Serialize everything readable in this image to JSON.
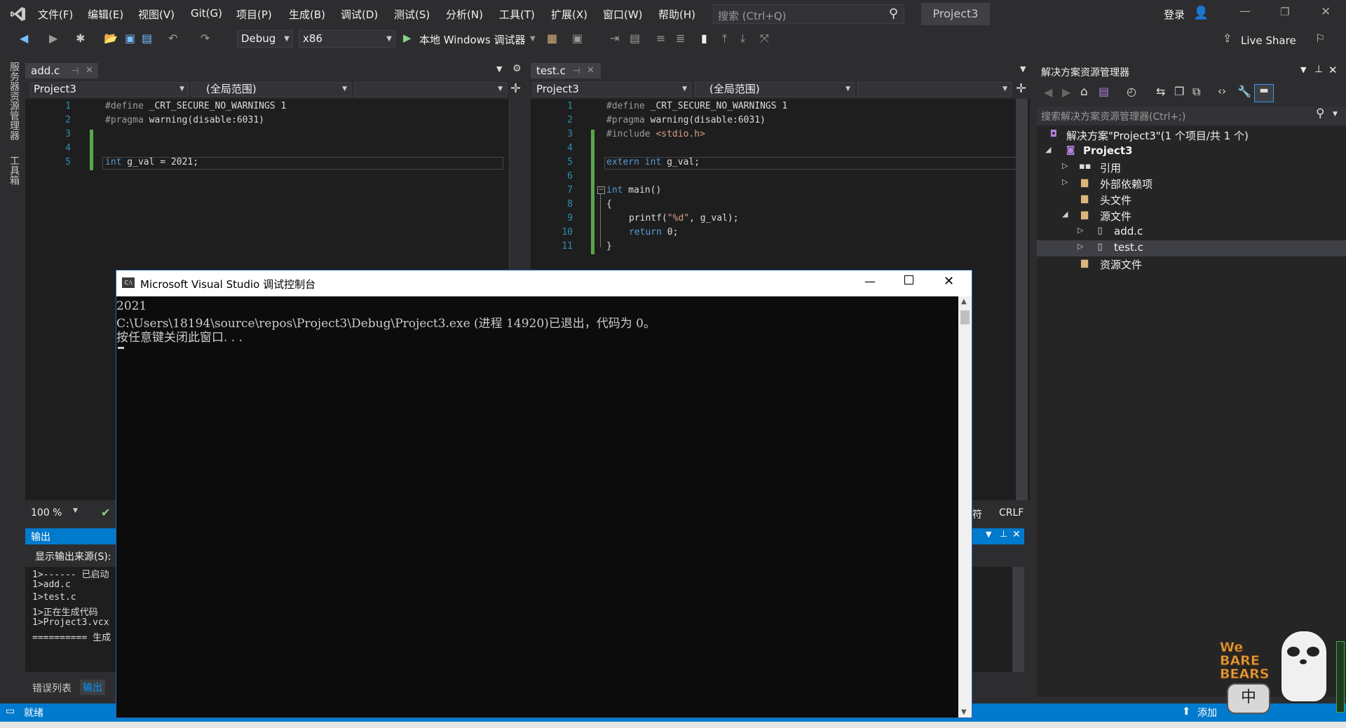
{
  "menubar": {
    "items": [
      "文件(F)",
      "编辑(E)",
      "视图(V)",
      "Git(G)",
      "项目(P)",
      "生成(B)",
      "调试(D)",
      "测试(S)",
      "分析(N)",
      "工具(T)",
      "扩展(X)",
      "窗口(W)",
      "帮助(H)"
    ],
    "search_placeholder": "搜索 (Ctrl+Q)",
    "project_title": "Project3",
    "login_label": "登录"
  },
  "toolbar": {
    "config": "Debug",
    "platform": "x86",
    "run_label": "本地 Windows 调试器",
    "live_share": "Live Share"
  },
  "left_strip": {
    "server_explorer": "服务器资源管理器",
    "toolbox": "工具箱"
  },
  "editor_left": {
    "tab": "add.c",
    "project": "Project3",
    "scope": "(全局范围)",
    "zoom": "100 %",
    "line_numbers": [
      "1",
      "2",
      "3",
      "4",
      "5"
    ]
  },
  "editor_right": {
    "tab": "test.c",
    "project": "Project3",
    "scope": "(全局范围)",
    "line_numbers": [
      "1",
      "2",
      "3",
      "4",
      "5",
      "6",
      "7",
      "8",
      "9",
      "10",
      "11"
    ],
    "status_char": "符",
    "line_ending": "CRLF"
  },
  "output": {
    "title": "输出",
    "source_label": "显示输出来源(S):",
    "lines": [
      "1>------ 已启动",
      "1>add.c",
      "1>test.c",
      "1>正在生成代码",
      "1>Project3.vcx",
      "========== 生成"
    ],
    "tabs": [
      "错误列表",
      "输出"
    ]
  },
  "solution_explorer": {
    "title": "解决方案资源管理器",
    "search_placeholder": "搜索解决方案资源管理器(Ctrl+;)",
    "solution_label": "解决方案\"Project3\"(1 个项目/共 1 个)",
    "project": "Project3",
    "items": [
      "引用",
      "外部依赖项",
      "头文件",
      "源文件",
      "add.c",
      "test.c",
      "资源文件"
    ]
  },
  "statusbar": {
    "ready": "就绪",
    "add_label": "添加"
  },
  "console": {
    "title": "Microsoft Visual Studio 调试控制台",
    "lines": [
      "2021",
      "C:\\Users\\18194\\source\\repos\\Project3\\Debug\\Project3.exe (进程 14920)已退出，代码为 0。",
      "按任意键关闭此窗口. . ."
    ]
  },
  "sticker": {
    "text1": "We BARE BEARS",
    "text2": "中"
  }
}
